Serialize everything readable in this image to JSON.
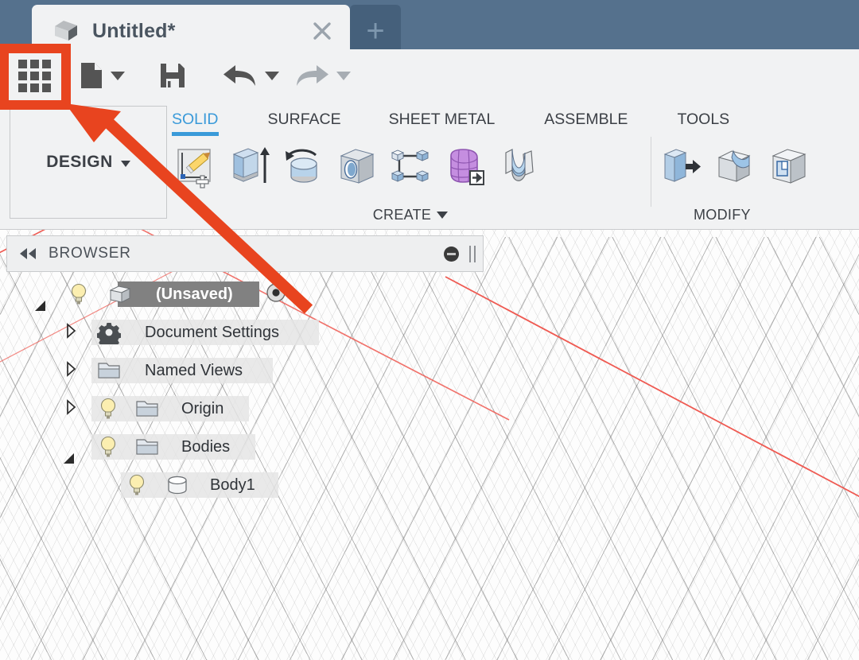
{
  "app": {
    "name": "Fusion 360",
    "accent_blue": "#3a9ad9",
    "chrome_blue": "#55718d",
    "annotation_red": "#e8441f",
    "panel_gray": "#f1f2f3"
  },
  "tabbar": {
    "document_tab": {
      "title": "Untitled*",
      "icon": "cube-icon",
      "close_icon": "close-icon"
    },
    "new_tab_label": "+"
  },
  "quick_access_toolbar": {
    "items": [
      {
        "name": "show-data-panel",
        "icon": "grid-icon",
        "label": "",
        "highlighted": true,
        "has_caret": false
      },
      {
        "name": "new-document",
        "icon": "file-icon",
        "label": "",
        "has_caret": true,
        "enabled": true
      },
      {
        "name": "save",
        "icon": "floppy-disk-icon",
        "label": "",
        "has_caret": false,
        "enabled": true
      },
      {
        "name": "undo",
        "icon": "undo-arrow-icon",
        "label": "",
        "has_caret": true,
        "enabled": true
      },
      {
        "name": "redo",
        "icon": "redo-arrow-icon",
        "label": "",
        "has_caret": true,
        "enabled": false
      }
    ]
  },
  "ribbon": {
    "workspace_selector": {
      "label": "DESIGN",
      "caret_icon": "chevron-down-icon"
    },
    "tabs": [
      {
        "label": "SOLID",
        "active": true
      },
      {
        "label": "SURFACE",
        "active": false
      },
      {
        "label": "SHEET METAL",
        "active": false
      },
      {
        "label": "ASSEMBLE",
        "active": false
      },
      {
        "label": "TOOLS",
        "active": false
      }
    ],
    "groups": [
      {
        "label": "CREATE",
        "has_caret": true,
        "commands": [
          {
            "name": "create-sketch",
            "icon": "sketch-pencil-icon"
          },
          {
            "name": "extrude",
            "icon": "extrude-icon"
          },
          {
            "name": "revolve",
            "icon": "revolve-icon"
          },
          {
            "name": "hole",
            "icon": "hole-icon"
          },
          {
            "name": "pattern",
            "icon": "pattern-icon"
          },
          {
            "name": "create-form",
            "icon": "create-form-icon"
          },
          {
            "name": "create-base-feature",
            "icon": "base-feature-icon"
          }
        ]
      },
      {
        "label": "MODIFY",
        "has_caret": false,
        "commands": [
          {
            "name": "press-pull",
            "icon": "press-pull-icon"
          },
          {
            "name": "fillet",
            "icon": "fillet-icon"
          },
          {
            "name": "shell",
            "icon": "shell-icon"
          }
        ]
      }
    ]
  },
  "browser": {
    "title": "BROWSER",
    "collapse_icon": "double-chevron-left-icon",
    "minimize_icon": "minimize-circle-icon",
    "resize_grip_icon": "resize-grip-icon",
    "tree": [
      {
        "label": "(Unsaved)",
        "depth": 0,
        "selected": true,
        "expander": "expanded",
        "has_bulb": true,
        "icon": "component-cube-icon",
        "trailing_icon": "radio-activate-icon"
      },
      {
        "label": "Document Settings",
        "depth": 1,
        "selected": false,
        "expander": "collapsed",
        "has_bulb": false,
        "icon": "gear-icon",
        "trailing_icon": ""
      },
      {
        "label": "Named Views",
        "depth": 1,
        "selected": false,
        "expander": "collapsed",
        "has_bulb": false,
        "icon": "folder-icon",
        "trailing_icon": ""
      },
      {
        "label": "Origin",
        "depth": 1,
        "selected": false,
        "expander": "collapsed",
        "has_bulb": true,
        "icon": "folder-icon",
        "trailing_icon": ""
      },
      {
        "label": "Bodies",
        "depth": 1,
        "selected": false,
        "expander": "expanded",
        "has_bulb": true,
        "icon": "folder-icon",
        "trailing_icon": ""
      },
      {
        "label": "Body1",
        "depth": 2,
        "selected": false,
        "expander": "none",
        "has_bulb": true,
        "icon": "cylinder-body-icon",
        "trailing_icon": ""
      }
    ]
  },
  "canvas": {
    "grid_type": "isometric",
    "axis_line_color": "#ef5a52",
    "background": "#fdfdfd"
  },
  "annotation": {
    "type": "arrow-callout",
    "color": "#e8441f",
    "points_to": "show-data-panel",
    "highlight_box": "show-data-panel"
  }
}
